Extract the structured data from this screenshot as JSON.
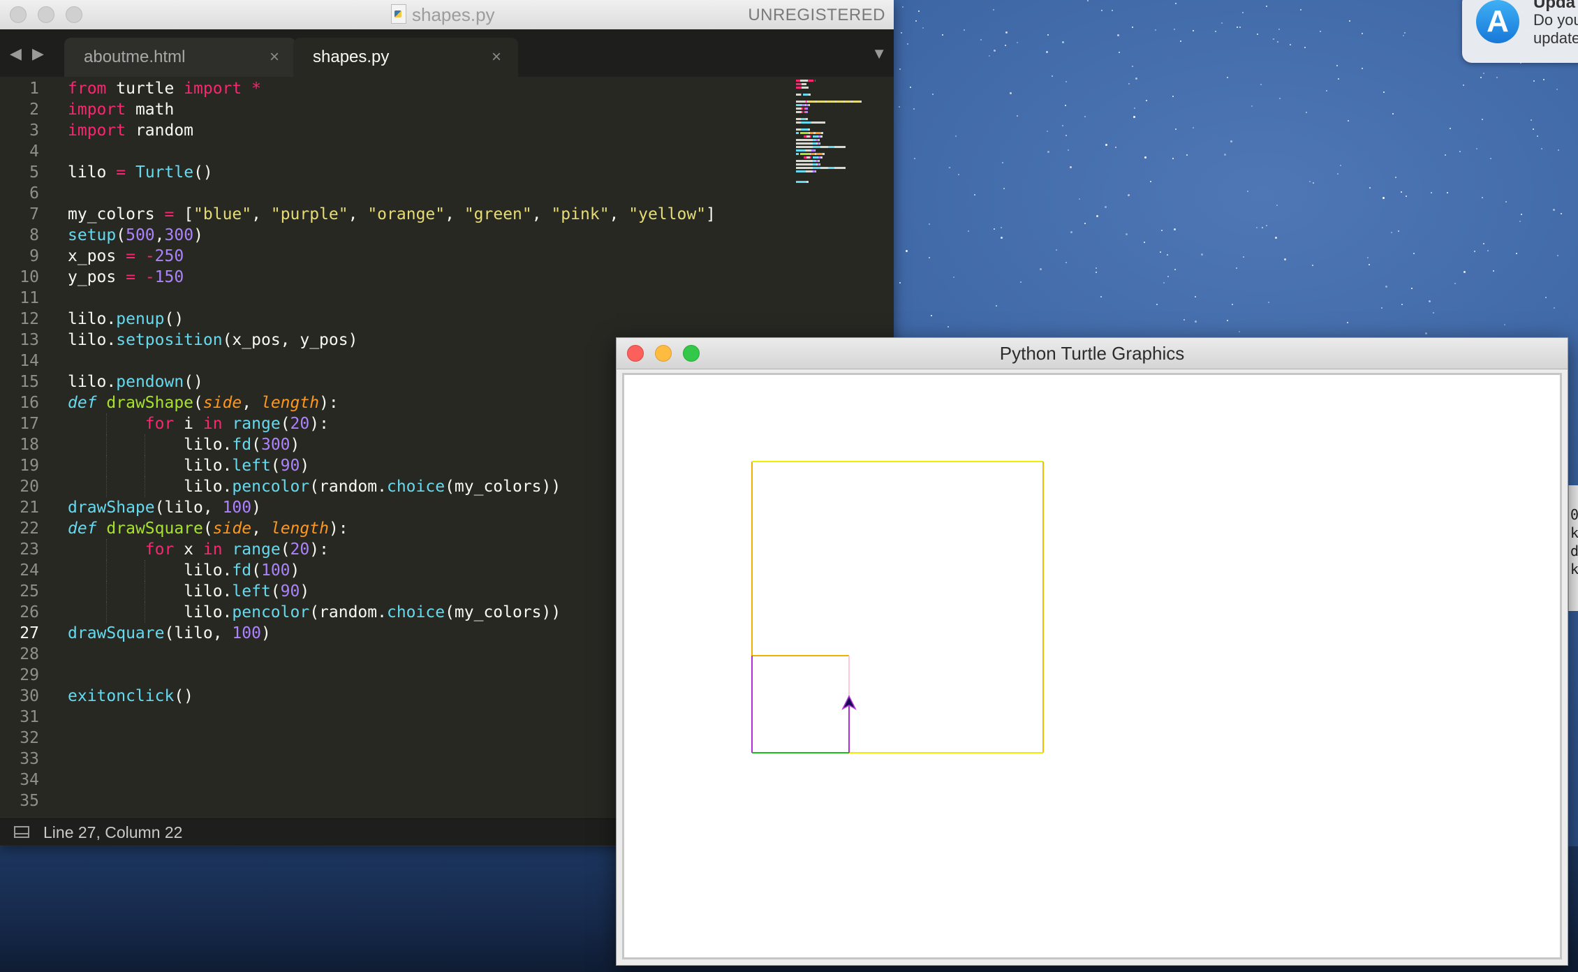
{
  "editor": {
    "window_title": "shapes.py",
    "license_label": "UNREGISTERED",
    "tabs": [
      {
        "label": "aboutme.html",
        "close": "×"
      },
      {
        "label": "shapes.py",
        "close": "×"
      }
    ],
    "nav_back": "◀",
    "nav_forward": "▶",
    "tab_menu": "▼",
    "current_line": 27,
    "line_numbers": [
      "1",
      "2",
      "3",
      "4",
      "5",
      "6",
      "7",
      "8",
      "9",
      "10",
      "11",
      "12",
      "13",
      "14",
      "15",
      "16",
      "17",
      "18",
      "19",
      "20",
      "21",
      "22",
      "23",
      "24",
      "25",
      "26",
      "27",
      "28",
      "29",
      "30",
      "31",
      "32",
      "33",
      "34",
      "35"
    ],
    "status": "Line 27, Column 22",
    "code": [
      [
        {
          "t": "from",
          "c": "kw"
        },
        {
          "t": " turtle "
        },
        {
          "t": "import",
          "c": "kw"
        },
        {
          "t": " "
        },
        {
          "t": "*",
          "c": "kw"
        }
      ],
      [
        {
          "t": "import",
          "c": "kw"
        },
        {
          "t": " math"
        }
      ],
      [
        {
          "t": "import",
          "c": "kw"
        },
        {
          "t": " random"
        }
      ],
      [],
      [
        {
          "t": "lilo "
        },
        {
          "t": "=",
          "c": "kw"
        },
        {
          "t": " "
        },
        {
          "t": "Turtle",
          "c": "fn"
        },
        {
          "t": "()"
        }
      ],
      [],
      [
        {
          "t": "my_colors "
        },
        {
          "t": "=",
          "c": "kw"
        },
        {
          "t": " ["
        },
        {
          "t": "\"blue\"",
          "c": "str"
        },
        {
          "t": ", "
        },
        {
          "t": "\"purple\"",
          "c": "str"
        },
        {
          "t": ", "
        },
        {
          "t": "\"orange\"",
          "c": "str"
        },
        {
          "t": ", "
        },
        {
          "t": "\"green\"",
          "c": "str"
        },
        {
          "t": ", "
        },
        {
          "t": "\"pink\"",
          "c": "str"
        },
        {
          "t": ", "
        },
        {
          "t": "\"yellow\"",
          "c": "str"
        },
        {
          "t": "]"
        }
      ],
      [
        {
          "t": "setup",
          "c": "fn"
        },
        {
          "t": "("
        },
        {
          "t": "500",
          "c": "num"
        },
        {
          "t": ","
        },
        {
          "t": "300",
          "c": "num"
        },
        {
          "t": ")"
        }
      ],
      [
        {
          "t": "x_pos "
        },
        {
          "t": "=",
          "c": "kw"
        },
        {
          "t": " "
        },
        {
          "t": "-",
          "c": "kw"
        },
        {
          "t": "250",
          "c": "num"
        }
      ],
      [
        {
          "t": "y_pos "
        },
        {
          "t": "=",
          "c": "kw"
        },
        {
          "t": " "
        },
        {
          "t": "-",
          "c": "kw"
        },
        {
          "t": "150",
          "c": "num"
        }
      ],
      [],
      [
        {
          "t": "lilo."
        },
        {
          "t": "penup",
          "c": "fn"
        },
        {
          "t": "()"
        }
      ],
      [
        {
          "t": "lilo."
        },
        {
          "t": "setposition",
          "c": "fn"
        },
        {
          "t": "(x_pos, y_pos)"
        }
      ],
      [],
      [
        {
          "t": "lilo."
        },
        {
          "t": "pendown",
          "c": "fn"
        },
        {
          "t": "()"
        }
      ],
      [
        {
          "t": "def",
          "c": "def"
        },
        {
          "t": " "
        },
        {
          "t": "drawShape",
          "c": "dname"
        },
        {
          "t": "("
        },
        {
          "t": "side",
          "c": "param"
        },
        {
          "t": ", "
        },
        {
          "t": "length",
          "c": "param"
        },
        {
          "t": "):"
        }
      ],
      [
        {
          "t": "        "
        },
        {
          "t": "for",
          "c": "kw"
        },
        {
          "t": " i "
        },
        {
          "t": "in",
          "c": "kw"
        },
        {
          "t": " "
        },
        {
          "t": "range",
          "c": "fn"
        },
        {
          "t": "("
        },
        {
          "t": "20",
          "c": "num"
        },
        {
          "t": "):"
        }
      ],
      [
        {
          "t": "            lilo."
        },
        {
          "t": "fd",
          "c": "fn"
        },
        {
          "t": "("
        },
        {
          "t": "300",
          "c": "num"
        },
        {
          "t": ")"
        }
      ],
      [
        {
          "t": "            lilo."
        },
        {
          "t": "left",
          "c": "fn"
        },
        {
          "t": "("
        },
        {
          "t": "90",
          "c": "num"
        },
        {
          "t": ")"
        }
      ],
      [
        {
          "t": "            lilo."
        },
        {
          "t": "pencolor",
          "c": "fn"
        },
        {
          "t": "(random."
        },
        {
          "t": "choice",
          "c": "fn"
        },
        {
          "t": "(my_colors))"
        }
      ],
      [
        {
          "t": "drawShape",
          "c": "fn"
        },
        {
          "t": "(lilo, "
        },
        {
          "t": "100",
          "c": "num"
        },
        {
          "t": ")"
        }
      ],
      [
        {
          "t": "def",
          "c": "def"
        },
        {
          "t": " "
        },
        {
          "t": "drawSquare",
          "c": "dname"
        },
        {
          "t": "("
        },
        {
          "t": "side",
          "c": "param"
        },
        {
          "t": ", "
        },
        {
          "t": "length",
          "c": "param"
        },
        {
          "t": "):"
        }
      ],
      [
        {
          "t": "        "
        },
        {
          "t": "for",
          "c": "kw"
        },
        {
          "t": " x "
        },
        {
          "t": "in",
          "c": "kw"
        },
        {
          "t": " "
        },
        {
          "t": "range",
          "c": "fn"
        },
        {
          "t": "("
        },
        {
          "t": "20",
          "c": "num"
        },
        {
          "t": "):"
        }
      ],
      [
        {
          "t": "            lilo."
        },
        {
          "t": "fd",
          "c": "fn"
        },
        {
          "t": "("
        },
        {
          "t": "100",
          "c": "num"
        },
        {
          "t": ")"
        }
      ],
      [
        {
          "t": "            lilo."
        },
        {
          "t": "left",
          "c": "fn"
        },
        {
          "t": "("
        },
        {
          "t": "90",
          "c": "num"
        },
        {
          "t": ")"
        }
      ],
      [
        {
          "t": "            lilo."
        },
        {
          "t": "pencolor",
          "c": "fn"
        },
        {
          "t": "(random."
        },
        {
          "t": "choice",
          "c": "fn"
        },
        {
          "t": "(my_colors))"
        }
      ],
      [
        {
          "t": "drawSquare",
          "c": "fn"
        },
        {
          "t": "(lilo, "
        },
        {
          "t": "100",
          "c": "num"
        },
        {
          "t": ")"
        }
      ],
      [],
      [],
      [
        {
          "t": "exitonclick",
          "c": "fn"
        },
        {
          "t": "()"
        }
      ],
      [],
      [],
      [],
      [],
      []
    ]
  },
  "turtle_window": {
    "title": "Python Turtle Graphics"
  },
  "notification": {
    "title": "Upda",
    "line1": "Do you",
    "line2": "update"
  },
  "behind_window": {
    "chars": [
      "0",
      "k",
      "d",
      "k"
    ]
  },
  "colors": {
    "editor_bg": "#272822",
    "keyword": "#f92672",
    "function": "#66d9ef",
    "number": "#ae81ff",
    "string": "#e6db74",
    "drawing": {
      "yellow": "#eeee00",
      "orange": "#f0b000",
      "purple": "#b030d8",
      "green": "#19c019",
      "pink": "#ffc8d8"
    }
  }
}
